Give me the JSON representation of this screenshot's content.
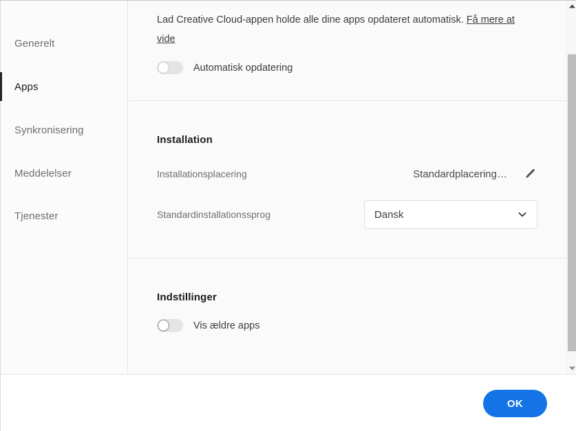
{
  "theme": {
    "accent": "#1473E6",
    "panel_bg": "#FAFAFA",
    "sidebar_bg": "#FBFBFB",
    "divider": "#E6E6E6",
    "text_primary": "#1B1B1B",
    "text_secondary": "#6E6E6E",
    "toggle_track_off": "#E4E4E4",
    "scrollbar_thumb": "#BDBDBD"
  },
  "sidebar": {
    "items": [
      {
        "label": "Generelt",
        "active": false,
        "name": "sidebar-item-generelt"
      },
      {
        "label": "Apps",
        "active": true,
        "name": "sidebar-item-apps"
      },
      {
        "label": "Synkronisering",
        "active": false,
        "name": "sidebar-item-synkronisering"
      },
      {
        "label": "Meddelelser",
        "active": false,
        "name": "sidebar-item-meddelelser"
      },
      {
        "label": "Tjenester",
        "active": false,
        "name": "sidebar-item-tjenester"
      }
    ]
  },
  "updates_section": {
    "description": "Lad Creative Cloud-appen holde alle dine apps opdateret automatisk.",
    "link_label": "Få mere at vide",
    "auto_update": {
      "label": "Automatisk opdatering",
      "state": "off"
    }
  },
  "installation_section": {
    "title": "Installation",
    "location": {
      "label": "Installationsplacering",
      "value": "Standardplacering…",
      "edit_icon": "pencil-icon"
    },
    "language": {
      "label": "Standardinstallationssprog",
      "selected": "Dansk",
      "chevron_icon": "chevron-down-icon"
    }
  },
  "settings_section": {
    "title": "Indstillinger",
    "show_older_apps": {
      "label": "Vis ældre apps",
      "state": "off"
    }
  },
  "scrollbar": {
    "up_icon": "triangle-up-icon",
    "down_icon": "triangle-down-icon",
    "thumb_name": "scrollbar-thumb"
  },
  "footer": {
    "ok_label": "OK"
  }
}
